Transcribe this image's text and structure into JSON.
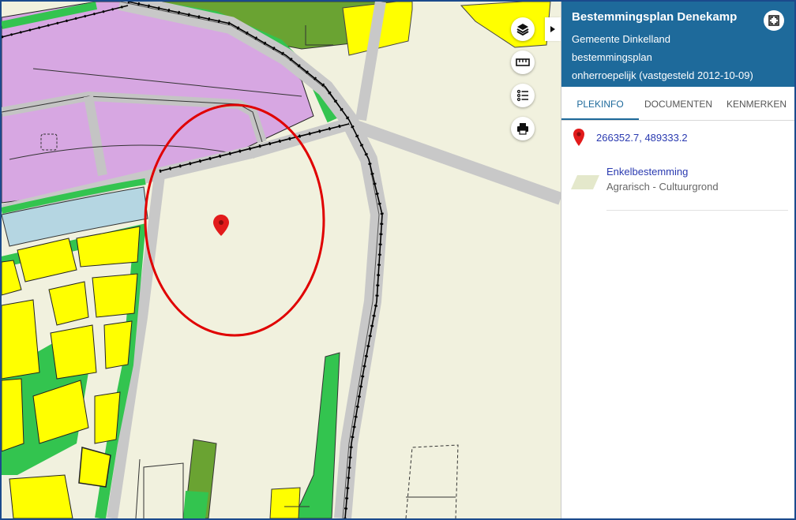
{
  "panel": {
    "title": "Bestemmingsplan Denekamp",
    "lines": [
      "Gemeente Dinkelland",
      "bestemmingsplan",
      "onherroepelijk (vastgesteld 2012-10-09)"
    ],
    "tabs": [
      {
        "label": "PLEKINFO",
        "active": true
      },
      {
        "label": "DOCUMENTEN",
        "active": false
      },
      {
        "label": "KENMERKEN",
        "active": false
      }
    ],
    "coordinates": "266352.7, 489333.2",
    "result": {
      "title": "Enkelbestemming",
      "subtitle": "Agrarisch - Cultuurgrond"
    }
  },
  "icons": {
    "layers": "layers-icon",
    "measure": "ruler-icon",
    "legend": "legend-list-icon",
    "print": "printer-icon",
    "collapse": "chevron-right-icon",
    "fullscreen": "fullscreen-icon",
    "marker": "map-marker-icon"
  },
  "colors": {
    "header": "#1e6a9b",
    "link": "#2a3ab0",
    "agrarisch": "#f1f1de",
    "wonen": "#ffff00",
    "groen": "#33c44f",
    "bedrijf": "#d7a7e2",
    "water": "#b5d6e2",
    "verkeer": "#c8c8c8",
    "marker": "#e21b1b",
    "highlight": "#e00000"
  }
}
